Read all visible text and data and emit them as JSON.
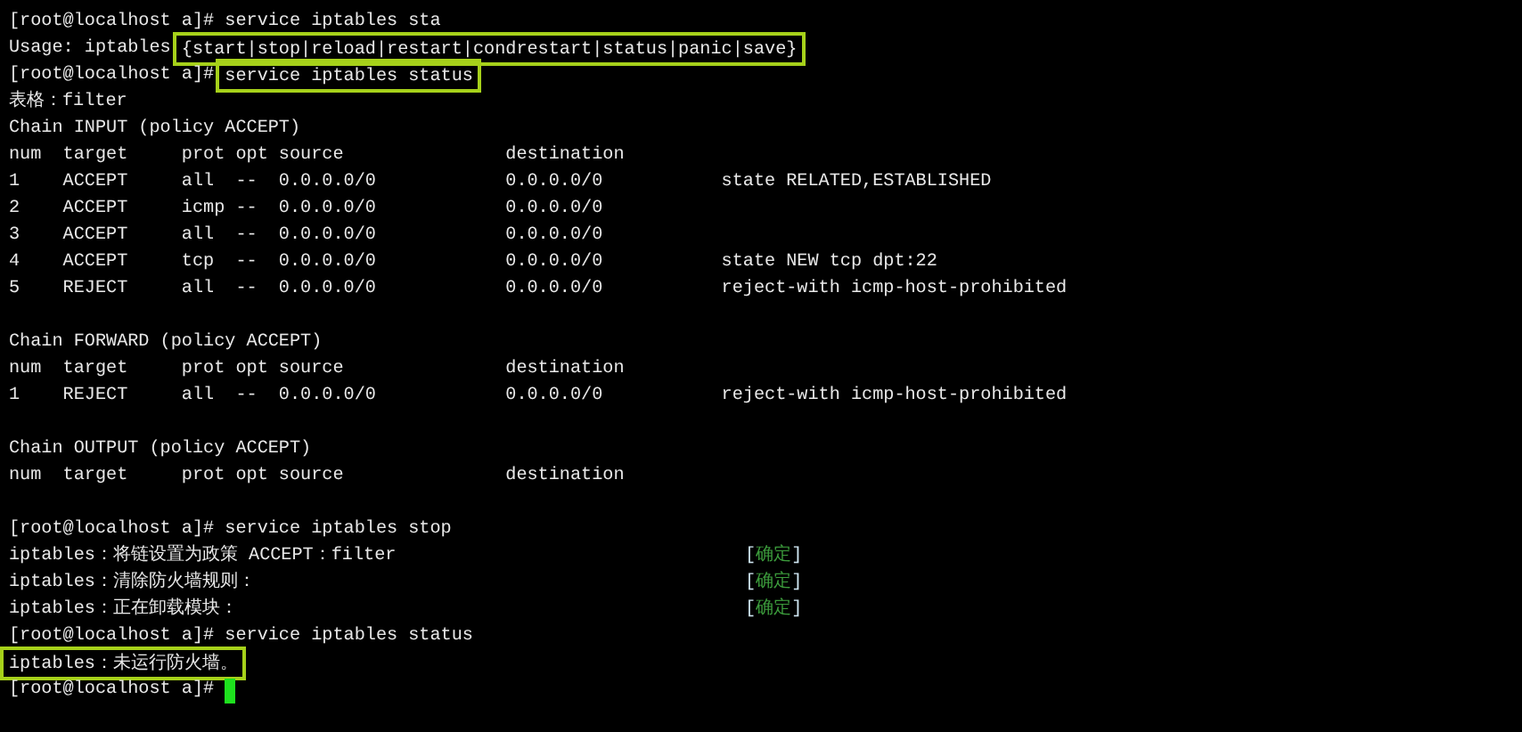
{
  "terminal": {
    "lines": [
      {
        "segments": [
          {
            "text": "[root@localhost a]# service iptables sta",
            "boxed": false
          }
        ]
      },
      {
        "segments": [
          {
            "text": "Usage: iptables ",
            "boxed": false
          },
          {
            "text": "{start|stop|reload|restart|condrestart|status|panic|save}",
            "boxed": true
          }
        ]
      },
      {
        "segments": [
          {
            "text": "[root@localhost a]# ",
            "boxed": false
          },
          {
            "text": "service iptables status",
            "boxed": true
          }
        ]
      },
      {
        "segments": [
          {
            "text": "表格：filter",
            "boxed": false
          }
        ]
      },
      {
        "segments": [
          {
            "text": "Chain INPUT (policy ACCEPT)",
            "boxed": false
          }
        ]
      },
      {
        "segments": [
          {
            "text": "num  target     prot opt source               destination",
            "boxed": false
          }
        ]
      },
      {
        "segments": [
          {
            "text": "1    ACCEPT     all  --  0.0.0.0/0            0.0.0.0/0           state RELATED,ESTABLISHED",
            "boxed": false
          }
        ]
      },
      {
        "segments": [
          {
            "text": "2    ACCEPT     icmp --  0.0.0.0/0            0.0.0.0/0",
            "boxed": false
          }
        ]
      },
      {
        "segments": [
          {
            "text": "3    ACCEPT     all  --  0.0.0.0/0            0.0.0.0/0",
            "boxed": false
          }
        ]
      },
      {
        "segments": [
          {
            "text": "4    ACCEPT     tcp  --  0.0.0.0/0            0.0.0.0/0           state NEW tcp dpt:22",
            "boxed": false
          }
        ]
      },
      {
        "segments": [
          {
            "text": "5    REJECT     all  --  0.0.0.0/0            0.0.0.0/0           reject-with icmp-host-prohibited",
            "boxed": false
          }
        ]
      },
      {
        "segments": [
          {
            "text": "Chain FORWARD (policy ACCEPT)",
            "boxed": false
          }
        ],
        "blank_line_before": true
      },
      {
        "segments": [
          {
            "text": "num  target     prot opt source               destination",
            "boxed": false
          }
        ]
      },
      {
        "segments": [
          {
            "text": "1    REJECT     all  --  0.0.0.0/0            0.0.0.0/0           reject-with icmp-host-prohibited",
            "boxed": false
          }
        ]
      },
      {
        "segments": [
          {
            "text": "Chain OUTPUT (policy ACCEPT)",
            "boxed": false
          }
        ],
        "blank_line_before": true
      },
      {
        "segments": [
          {
            "text": "num  target     prot opt source               destination",
            "boxed": false
          }
        ]
      },
      {
        "segments": [
          {
            "text": "[root@localhost a]# service iptables stop",
            "boxed": false
          }
        ],
        "blank_line_before": true
      },
      {
        "segments": [
          {
            "text": "iptables：将链设置为政策 ACCEPT：filter",
            "boxed": false
          }
        ],
        "status": {
          "open": "[",
          "label": "确定",
          "close": "]"
        }
      },
      {
        "segments": [
          {
            "text": "iptables：清除防火墙规则：",
            "boxed": false
          }
        ],
        "status": {
          "open": "[",
          "label": "确定",
          "close": "]"
        }
      },
      {
        "segments": [
          {
            "text": "iptables：正在卸载模块：",
            "boxed": false
          }
        ],
        "status": {
          "open": "[",
          "label": "确定",
          "close": "]"
        }
      },
      {
        "segments": [
          {
            "text": "[root@localhost a]# service iptables status",
            "boxed": false
          }
        ]
      },
      {
        "segments": [
          {
            "text": "iptables：未运行防火墙。",
            "boxed": true
          }
        ]
      },
      {
        "segments": [
          {
            "text": "[root@localhost a]# ",
            "boxed": false
          }
        ],
        "cursor": true
      }
    ]
  }
}
